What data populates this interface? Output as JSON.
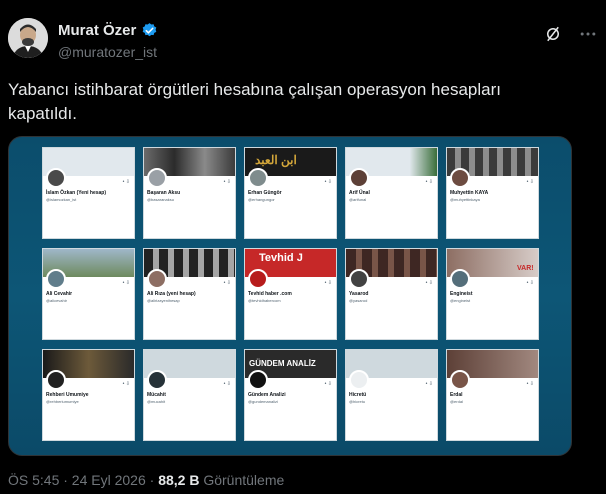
{
  "author": {
    "name": "Murat Özer",
    "handle": "@muratozer_ist"
  },
  "tweet": {
    "text": "Yabancı istihbarat örgütleri hesabına çalışan operasyon hesapları kapatıldı."
  },
  "cards": [
    {
      "name": "İslam Özkan (Yeni hesap)",
      "handle": "@islamozkan_ist"
    },
    {
      "name": "Başaran Aksu",
      "handle": "@basaranaksu"
    },
    {
      "name": "Erhan Güngör",
      "handle": "@erhangungor"
    },
    {
      "name": "Arif Ünal",
      "handle": "@arifunal"
    },
    {
      "name": "Muhyettin KAYA",
      "handle": "@muhyettinkaya"
    },
    {
      "name": "Ali Cevahir",
      "handle": "@alicevahir"
    },
    {
      "name": "Ali Rıza (yeni hesap)",
      "handle": "@alirizayenihesap"
    },
    {
      "name": "Tevhid haber .com",
      "handle": "@tevhidhabercom"
    },
    {
      "name": "Yasarod",
      "handle": "@yasarod"
    },
    {
      "name": "Engineist",
      "handle": "@engineist"
    },
    {
      "name": "Rehberi Umumiye",
      "handle": "@rehberiumumiye"
    },
    {
      "name": "Mücahit",
      "handle": "@mucahit"
    },
    {
      "name": "Gündem Analizi",
      "handle": "@gundemanalizi"
    },
    {
      "name": "Hicretü",
      "handle": "@hicretu"
    },
    {
      "name": "Erdal",
      "handle": "@erdal"
    }
  ],
  "banner_texts": {
    "card3": "ابن العبد",
    "card8": "Tevhid J",
    "card13": "GÜNDEM ANALİZ",
    "card10": "VAR!"
  },
  "footer": {
    "time": "ÖS 5:45 · 24 Eyl 2026 ·",
    "views": "88,2 B",
    "views_label": "Görüntüleme"
  },
  "colors": {
    "accent": "#1d9bf0",
    "background": "#000000",
    "secondary_text": "#71767b"
  },
  "icons": [
    "grok-icon",
    "more-icon",
    "verified-icon"
  ]
}
